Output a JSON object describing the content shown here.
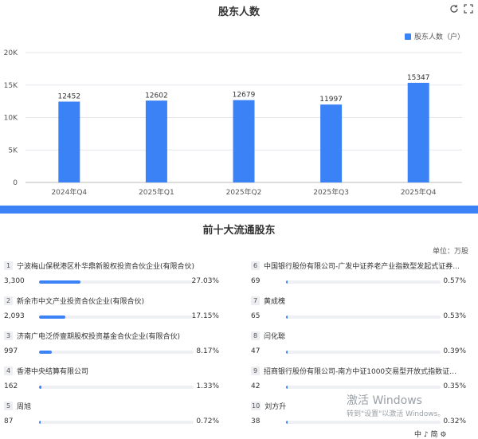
{
  "chart_data": {
    "type": "bar",
    "title": "股东人数",
    "categories": [
      "2024年Q4",
      "2025年Q1",
      "2025年Q2",
      "2025年Q3",
      "2025年Q4"
    ],
    "series": [
      {
        "name": "股东人数（户）",
        "values": [
          12452,
          12602,
          12679,
          11997,
          15347
        ]
      }
    ],
    "yticks": [
      "0",
      "5K",
      "10K",
      "15K",
      "20K"
    ],
    "ylim": [
      0,
      20000
    ],
    "grid": true,
    "legend_position": "top-right",
    "bar_color": "#3b82f6"
  },
  "toolbar": {
    "refresh_icon": "refresh-icon",
    "expand_icon": "expand-icon"
  },
  "shareholders": {
    "title": "前十大流通股东",
    "unit": "单位：万股",
    "items": [
      {
        "rank": "1",
        "name": "宁波梅山保税港区朴华鼎新股权投资合伙企业(有限合伙)",
        "amount": "3,300",
        "percent": "27.03%",
        "ratio": 0.2703
      },
      {
        "rank": "2",
        "name": "新余市中文产业投资合伙企业(有限合伙)",
        "amount": "2,093",
        "percent": "17.15%",
        "ratio": 0.1715
      },
      {
        "rank": "3",
        "name": "济南广电泛侨壹期股权投资基金合伙企业(有限合伙)",
        "amount": "997",
        "percent": "8.17%",
        "ratio": 0.0817
      },
      {
        "rank": "4",
        "name": "香港中央结算有限公司",
        "amount": "162",
        "percent": "1.33%",
        "ratio": 0.0133
      },
      {
        "rank": "5",
        "name": "周旭",
        "amount": "87",
        "percent": "0.72%",
        "ratio": 0.0072
      },
      {
        "rank": "6",
        "name": "中国银行股份有限公司-广发中证养老产业指数型发起式证券...",
        "amount": "69",
        "percent": "0.57%",
        "ratio": 0.0057
      },
      {
        "rank": "7",
        "name": "黄成槐",
        "amount": "65",
        "percent": "0.53%",
        "ratio": 0.0053
      },
      {
        "rank": "8",
        "name": "闫化聪",
        "amount": "47",
        "percent": "0.39%",
        "ratio": 0.0039
      },
      {
        "rank": "9",
        "name": "招商银行股份有限公司-南方中证1000交易型开放式指数证券...",
        "amount": "42",
        "percent": "0.35%",
        "ratio": 0.0035
      },
      {
        "rank": "10",
        "name": "刘方升",
        "amount": "38",
        "percent": "0.32%",
        "ratio": 0.0032
      }
    ]
  },
  "watermark": {
    "line1": "激活 Windows",
    "line2": "转到\"设置\"以激活 Windows。"
  },
  "taskbar": {
    "text": "中 ♪ 简 ⚙"
  }
}
